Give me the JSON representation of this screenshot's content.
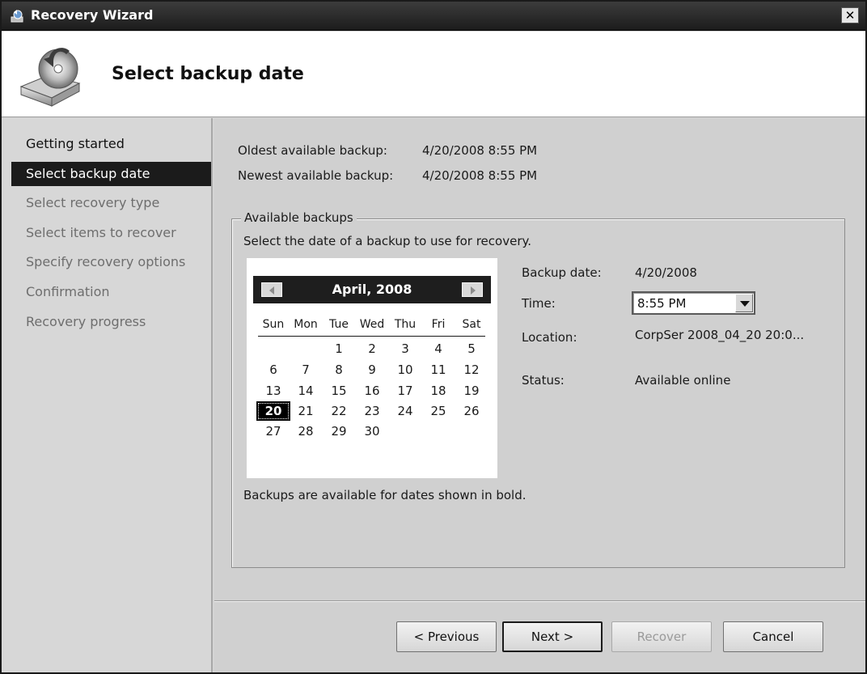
{
  "window": {
    "title": "Recovery Wizard",
    "close_label": "✕"
  },
  "header": {
    "title": "Select backup date"
  },
  "steps": [
    {
      "label": "Getting started",
      "state": "completed"
    },
    {
      "label": "Select backup date",
      "state": "active"
    },
    {
      "label": "Select recovery type",
      "state": "pending"
    },
    {
      "label": "Select items to recover",
      "state": "pending"
    },
    {
      "label": "Specify recovery options",
      "state": "pending"
    },
    {
      "label": "Confirmation",
      "state": "pending"
    },
    {
      "label": "Recovery progress",
      "state": "pending"
    }
  ],
  "summary": {
    "oldest_label": "Oldest available backup:",
    "oldest_value": "4/20/2008 8:55 PM",
    "newest_label": "Newest available backup:",
    "newest_value": "4/20/2008 8:55 PM"
  },
  "available": {
    "legend": "Available backups",
    "instruction": "Select the date of a backup to use for recovery.",
    "bold_note": "Backups are available for dates shown in bold."
  },
  "calendar": {
    "month_label": "April, 2008",
    "weekdays": [
      "Sun",
      "Mon",
      "Tue",
      "Wed",
      "Thu",
      "Fri",
      "Sat"
    ],
    "weeks": [
      [
        "",
        "",
        "1",
        "2",
        "3",
        "4",
        "5"
      ],
      [
        "6",
        "7",
        "8",
        "9",
        "10",
        "11",
        "12"
      ],
      [
        "13",
        "14",
        "15",
        "16",
        "17",
        "18",
        "19"
      ],
      [
        "20",
        "21",
        "22",
        "23",
        "24",
        "25",
        "26"
      ],
      [
        "27",
        "28",
        "29",
        "30",
        "",
        "",
        ""
      ]
    ],
    "selected_day": "20"
  },
  "details": {
    "backup_date_label": "Backup date:",
    "backup_date_value": "4/20/2008",
    "time_label": "Time:",
    "time_value": "8:55 PM",
    "location_label": "Location:",
    "location_value": "CorpSer 2008_04_20 20:0...",
    "status_label": "Status:",
    "status_value": "Available online"
  },
  "buttons": {
    "previous": "< Previous",
    "next": "Next >",
    "recover": "Recover",
    "cancel": "Cancel"
  }
}
